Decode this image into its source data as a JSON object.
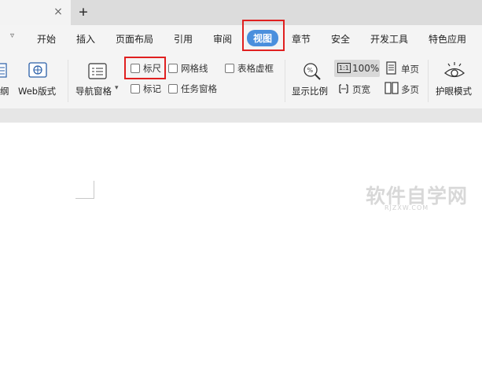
{
  "tab_bar": {
    "close_glyph": "×",
    "new_tab_glyph": "+"
  },
  "menu": {
    "items": [
      {
        "label": "开始"
      },
      {
        "label": "插入"
      },
      {
        "label": "页面布局"
      },
      {
        "label": "引用"
      },
      {
        "label": "审阅"
      },
      {
        "label": "视图",
        "active": true
      },
      {
        "label": "章节"
      },
      {
        "label": "安全"
      },
      {
        "label": "开发工具"
      },
      {
        "label": "特色应用"
      }
    ],
    "overflow_glyph": "▿",
    "active_color": "#4a8fdd"
  },
  "ribbon": {
    "outline_label": "纲",
    "web_layout_label": "Web版式",
    "nav_pane_label": "导航窗格",
    "nav_pane_arrow": "▾",
    "checkboxes": [
      {
        "label": "标尺",
        "checked": false
      },
      {
        "label": "网格线",
        "checked": false
      },
      {
        "label": "表格虚框",
        "checked": false
      },
      {
        "label": "标记",
        "checked": false
      },
      {
        "label": "任务窗格",
        "checked": false
      }
    ],
    "zoom_ratio_label": "显示比例",
    "zoom_value": "100%",
    "zoom_icon_text": "1:1",
    "page_width_label": "页宽",
    "single_page_label": "单页",
    "multi_page_label": "多页",
    "eye_mode_label": "护眼模式"
  },
  "highlight_color": "#e02020",
  "watermark": {
    "cn": "软件自学网",
    "en": "RJZXW.COM"
  }
}
